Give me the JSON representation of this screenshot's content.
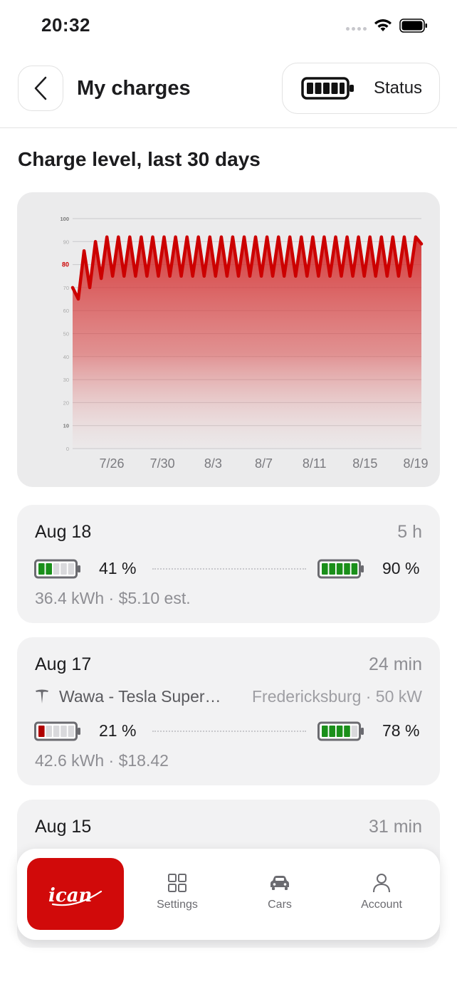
{
  "status_bar": {
    "time": "20:32"
  },
  "header": {
    "title": "My charges",
    "status_label": "Status"
  },
  "section_title": "Charge level, last 30 days",
  "chart_data": {
    "type": "area",
    "title": "",
    "xlabel": "",
    "ylabel": "",
    "ylim": [
      0,
      100
    ],
    "y_ticks": [
      "0",
      "10",
      "20",
      "30",
      "40",
      "50",
      "60",
      "70",
      "80",
      "90",
      "100"
    ],
    "highlight_y_tick": "80",
    "x_ticks": [
      "7/26",
      "7/30",
      "8/3",
      "8/7",
      "8/11",
      "8/15",
      "8/19"
    ],
    "grid": true,
    "line_color": "#cc0000",
    "series": [
      {
        "values": [
          70,
          65,
          86,
          70,
          90,
          74,
          92,
          75,
          92,
          75,
          92,
          75,
          92,
          75,
          92,
          75,
          92,
          75,
          92,
          75,
          92,
          75,
          92,
          75,
          92,
          75,
          92,
          75,
          92,
          75,
          92,
          75,
          92,
          75,
          92,
          75,
          92,
          75,
          92,
          75,
          92,
          75,
          92,
          75,
          92,
          75,
          92,
          75,
          92,
          75,
          92,
          75,
          92,
          75,
          92,
          75,
          92,
          75,
          92,
          75,
          92,
          89
        ]
      }
    ]
  },
  "charges": [
    {
      "date": "Aug 18",
      "duration": "5 h",
      "start_pct": "41 %",
      "end_pct": "90 %",
      "start_level": 0.41,
      "end_level": 0.9,
      "summary": "36.4 kWh · $5.10 est."
    },
    {
      "date": "Aug 17",
      "duration": "24 min",
      "location": "Wawa - Tesla Super…",
      "location_detail": "Fredericksburg · 50 kW",
      "start_pct": "21 %",
      "end_pct": "78 %",
      "start_level": 0.21,
      "end_level": 0.78,
      "summary": "42.6 kWh · $18.42"
    },
    {
      "date": "Aug 15",
      "duration": "31 min"
    }
  ],
  "nav": {
    "logo": "ican",
    "items": [
      {
        "label": "Settings",
        "icon": "grid-icon"
      },
      {
        "label": "Cars",
        "icon": "car-icon"
      },
      {
        "label": "Account",
        "icon": "person-icon"
      }
    ]
  },
  "colors": {
    "brand": "#d10a0a",
    "battery_green": "#1a8f1a",
    "battery_red": "#b00000"
  }
}
